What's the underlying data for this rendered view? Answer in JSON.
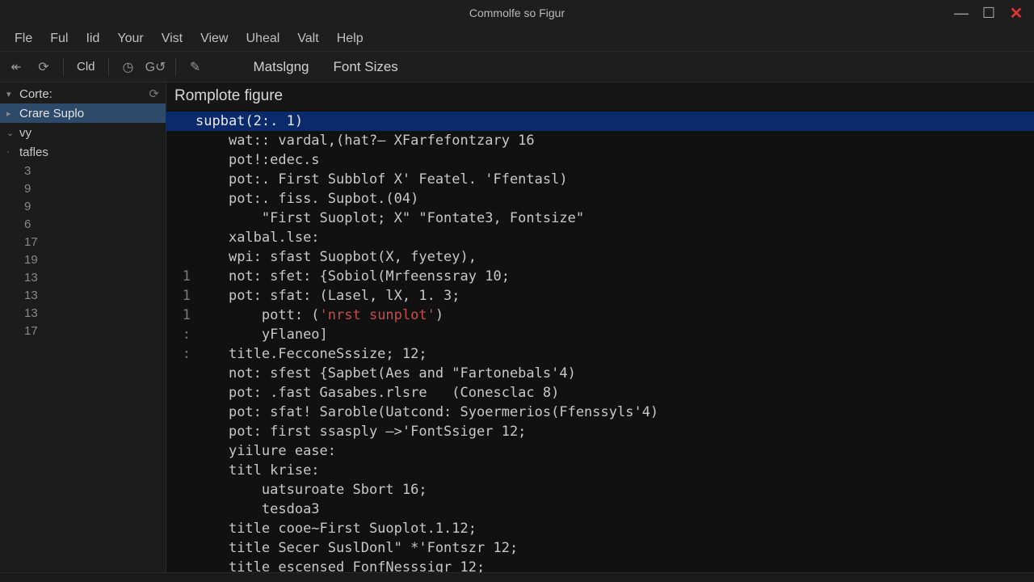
{
  "window": {
    "title": "Commolfe so Figur"
  },
  "menubar": [
    "Fle",
    "Ful",
    "Iid",
    "Your",
    "Vist",
    "View",
    "Uheal",
    "Valt",
    "Help"
  ],
  "toolbar": {
    "icons": [
      "back-arrow",
      "refresh",
      "text-cld",
      "history-1",
      "history-2",
      "marker"
    ],
    "cld_label": "Cld",
    "tabs": [
      "Matslgng",
      "Font Sizes"
    ]
  },
  "sidebar": {
    "header": "Corte:",
    "items": [
      {
        "label": "Crare Suplo",
        "selected": true,
        "caret": "right"
      },
      {
        "label": "vy",
        "caret": "down"
      },
      {
        "label": "tafles",
        "caret": "none"
      }
    ],
    "line_numbers": [
      "3",
      "9",
      "9",
      "6",
      "17",
      "19",
      "13",
      "13",
      "13",
      "17"
    ]
  },
  "editor": {
    "title": "Romplote figure",
    "lines": [
      {
        "text": "supbat(2:. 1)",
        "hl": true,
        "indent": 0,
        "mark": ""
      },
      {
        "text": "wat:: vardal,(hat?— XFarfefontzary 16",
        "indent": 1,
        "mark": ""
      },
      {
        "text": "pot!:edec.s",
        "indent": 1,
        "mark": ""
      },
      {
        "text": "pot:. First Subblof X' Featel. 'Ffentasl)",
        "indent": 1,
        "mark": ""
      },
      {
        "text": "pot:. fiss. Supbot.(04)",
        "indent": 1,
        "mark": ""
      },
      {
        "text": "\"First Suoplot; X\" \"Fontate3, Fontsize\"",
        "indent": 2,
        "mark": ""
      },
      {
        "text": "xalbal.lse:",
        "indent": 1,
        "mark": ""
      },
      {
        "text": "wpi: sfast Suopbot(X, fyetey),",
        "indent": 1,
        "mark": ""
      },
      {
        "text": "not: sfet: {Sobiol(Mrfeenssray 10;",
        "indent": 1,
        "mark": "1"
      },
      {
        "text": "pot: sfat: (Lasel, lX, 1. 3;",
        "indent": 1,
        "mark": "1"
      },
      {
        "text_pre": "pott: (",
        "text_red": "'nrst sunplot'",
        "text_post": ")",
        "indent": 2,
        "mark": "1",
        "has_red": true
      },
      {
        "text": "yFlaneo]",
        "indent": 2,
        "mark": ":"
      },
      {
        "text": "title.FecconeSssize; 12;",
        "indent": 1,
        "mark": ":"
      },
      {
        "text": "not: sfest {Sapbet(Aes and \"Fartonebals'4)",
        "indent": 1,
        "mark": ""
      },
      {
        "text": "pot: .fast Gasabes.rlsre   (Conesclac 8)",
        "indent": 1,
        "mark": ""
      },
      {
        "text": "pot: sfat! Saroble(Uatcond: Syoermerios(Ffenssyls'4)",
        "indent": 1,
        "mark": ""
      },
      {
        "text": "pot: first ssasply —>'FontSsiger 12;",
        "indent": 1,
        "mark": ""
      },
      {
        "text": "yiilure ease:",
        "indent": 1,
        "mark": ""
      },
      {
        "text": "titl krise:",
        "indent": 1,
        "mark": ""
      },
      {
        "text": "uatsuroate Sbort 16;",
        "indent": 2,
        "mark": ""
      },
      {
        "text": "tesdoa3",
        "indent": 2,
        "mark": ""
      },
      {
        "text": "title cooe~First Suoplot.1.12;",
        "indent": 1,
        "mark": ""
      },
      {
        "text": "title Secer SuslDonl\" *'Fontszr 12;",
        "indent": 1,
        "mark": ""
      },
      {
        "text": "title escensed FonfNesssigr 12;",
        "indent": 1,
        "mark": ""
      }
    ]
  }
}
